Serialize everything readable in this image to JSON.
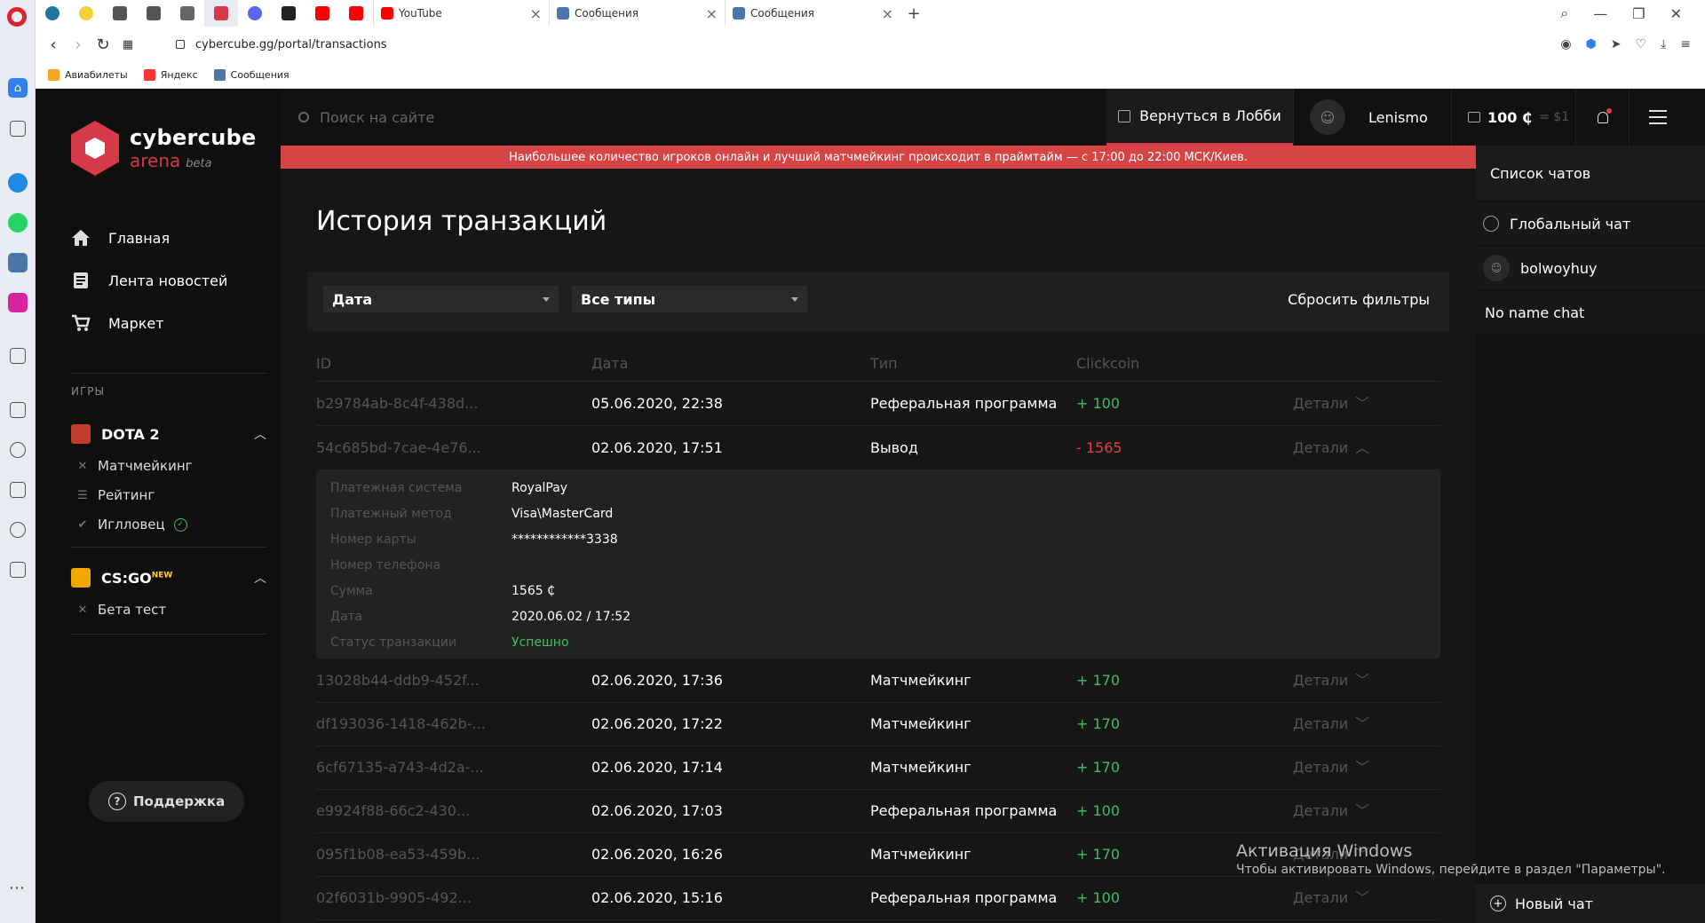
{
  "browser": {
    "tabs": [
      {
        "title": "YouTube",
        "fav_color": "#ff0000"
      },
      {
        "title": "Сообщения",
        "fav_color": "#4a76a8"
      },
      {
        "title": "Сообщения",
        "fav_color": "#4a76a8"
      }
    ],
    "new_tab": "+",
    "url": "cybercube.gg/portal/transactions",
    "bookmarks": [
      {
        "label": "Авиабилеты",
        "color": "#f5a623"
      },
      {
        "label": "Яндекс",
        "color": "#ff3333"
      },
      {
        "label": "Сообщения",
        "color": "#4a76a8"
      }
    ]
  },
  "brand": {
    "name": "cybercube",
    "sub": "arena",
    "tag": "beta",
    "color": "#d63a48"
  },
  "nav": [
    {
      "label": "Главная",
      "icon": "home-icon"
    },
    {
      "label": "Лента новостей",
      "icon": "news-icon"
    },
    {
      "label": "Маркет",
      "icon": "cart-icon"
    }
  ],
  "games_label": "ИГРЫ",
  "games": [
    {
      "name": "DOTA 2",
      "color": "#c23c2a",
      "items": [
        "Матчмейкинг",
        "Рейтинг",
        "Иглловец"
      ]
    },
    {
      "name": "CS:GO",
      "badge": "NEW",
      "color": "#f0a800",
      "items": [
        "Бета тест"
      ]
    }
  ],
  "support": "Поддержка",
  "header": {
    "search_placeholder": "Поиск на сайте",
    "lobby": "Вернуться в Лобби",
    "username": "Lenismo",
    "balance": "100 ₵",
    "balance_usd": "= $1"
  },
  "banner": "Наибольшее количество игроков онлайн и лучший матчмейкинг происходит в праймтайм — с 17:00 до 22:00 МСК/Киев.",
  "page_title": "История транзакций",
  "filters": {
    "date": "Дата",
    "type": "Все типы",
    "reset": "Сбросить фильтры"
  },
  "columns": {
    "id": "ID",
    "date": "Дата",
    "type": "Тип",
    "coin": "Clickcoin"
  },
  "details_label": "Детали",
  "rows": [
    {
      "id": "b29784ab-8c4f-438d...",
      "date": "05.06.2020, 22:38",
      "type": "Реферальная программа",
      "amount": "+ 100",
      "sign": "pos"
    },
    {
      "id": "54c685bd-7cae-4e76...",
      "date": "02.06.2020, 17:51",
      "type": "Вывод",
      "amount": "- 1565",
      "sign": "neg",
      "expanded": true
    },
    {
      "id": "13028b44-ddb9-452f...",
      "date": "02.06.2020, 17:36",
      "type": "Матчмейкинг",
      "amount": "+ 170",
      "sign": "pos"
    },
    {
      "id": "df193036-1418-462b-...",
      "date": "02.06.2020, 17:22",
      "type": "Матчмейкинг",
      "amount": "+ 170",
      "sign": "pos"
    },
    {
      "id": "6cf67135-a743-4d2a-...",
      "date": "02.06.2020, 17:14",
      "type": "Матчмейкинг",
      "amount": "+ 170",
      "sign": "pos"
    },
    {
      "id": "e9924f88-66c2-430...",
      "date": "02.06.2020, 17:03",
      "type": "Реферальная программа",
      "amount": "+ 100",
      "sign": "pos"
    },
    {
      "id": "095f1b08-ea53-459b...",
      "date": "02.06.2020, 16:26",
      "type": "Матчмейкинг",
      "amount": "+ 170",
      "sign": "pos"
    },
    {
      "id": "02f6031b-9905-492...",
      "date": "02.06.2020, 15:16",
      "type": "Реферальная программа",
      "amount": "+ 100",
      "sign": "pos"
    }
  ],
  "expanded_details": [
    {
      "k": "Платежная система",
      "v": "RoyalPay"
    },
    {
      "k": "Платежный метод",
      "v": "Visa\\MasterCard"
    },
    {
      "k": "Номер карты",
      "v": "************3338"
    },
    {
      "k": "Номер телефона",
      "v": ""
    },
    {
      "k": "Сумма",
      "v": "1565 ₵"
    },
    {
      "k": "Дата",
      "v": "2020.06.02 / 17:52"
    },
    {
      "k": "Статус транзакции",
      "v": "Успешно",
      "status": true
    }
  ],
  "chat": {
    "title": "Список чатов",
    "items": [
      {
        "label": "Глобальный чат",
        "icon": "globe-icon"
      },
      {
        "label": "bolwoyhuy",
        "icon": "avatar"
      },
      {
        "label": "No name chat",
        "icon": ""
      }
    ],
    "new_chat": "Новый чат"
  },
  "windows_activation": {
    "title": "Активация Windows",
    "text": "Чтобы активировать Windows, перейдите в раздел \"Параметры\"."
  }
}
